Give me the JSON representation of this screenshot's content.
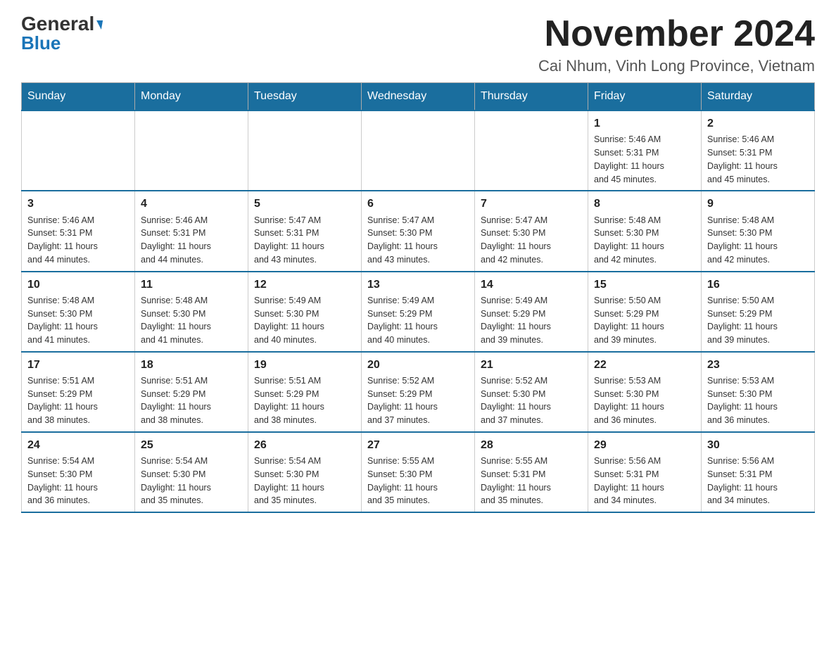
{
  "logo": {
    "general": "General",
    "blue": "Blue"
  },
  "title": "November 2024",
  "subtitle": "Cai Nhum, Vinh Long Province, Vietnam",
  "weekdays": [
    "Sunday",
    "Monday",
    "Tuesday",
    "Wednesday",
    "Thursday",
    "Friday",
    "Saturday"
  ],
  "weeks": [
    [
      {
        "day": "",
        "info": ""
      },
      {
        "day": "",
        "info": ""
      },
      {
        "day": "",
        "info": ""
      },
      {
        "day": "",
        "info": ""
      },
      {
        "day": "",
        "info": ""
      },
      {
        "day": "1",
        "info": "Sunrise: 5:46 AM\nSunset: 5:31 PM\nDaylight: 11 hours\nand 45 minutes."
      },
      {
        "day": "2",
        "info": "Sunrise: 5:46 AM\nSunset: 5:31 PM\nDaylight: 11 hours\nand 45 minutes."
      }
    ],
    [
      {
        "day": "3",
        "info": "Sunrise: 5:46 AM\nSunset: 5:31 PM\nDaylight: 11 hours\nand 44 minutes."
      },
      {
        "day": "4",
        "info": "Sunrise: 5:46 AM\nSunset: 5:31 PM\nDaylight: 11 hours\nand 44 minutes."
      },
      {
        "day": "5",
        "info": "Sunrise: 5:47 AM\nSunset: 5:31 PM\nDaylight: 11 hours\nand 43 minutes."
      },
      {
        "day": "6",
        "info": "Sunrise: 5:47 AM\nSunset: 5:30 PM\nDaylight: 11 hours\nand 43 minutes."
      },
      {
        "day": "7",
        "info": "Sunrise: 5:47 AM\nSunset: 5:30 PM\nDaylight: 11 hours\nand 42 minutes."
      },
      {
        "day": "8",
        "info": "Sunrise: 5:48 AM\nSunset: 5:30 PM\nDaylight: 11 hours\nand 42 minutes."
      },
      {
        "day": "9",
        "info": "Sunrise: 5:48 AM\nSunset: 5:30 PM\nDaylight: 11 hours\nand 42 minutes."
      }
    ],
    [
      {
        "day": "10",
        "info": "Sunrise: 5:48 AM\nSunset: 5:30 PM\nDaylight: 11 hours\nand 41 minutes."
      },
      {
        "day": "11",
        "info": "Sunrise: 5:48 AM\nSunset: 5:30 PM\nDaylight: 11 hours\nand 41 minutes."
      },
      {
        "day": "12",
        "info": "Sunrise: 5:49 AM\nSunset: 5:30 PM\nDaylight: 11 hours\nand 40 minutes."
      },
      {
        "day": "13",
        "info": "Sunrise: 5:49 AM\nSunset: 5:29 PM\nDaylight: 11 hours\nand 40 minutes."
      },
      {
        "day": "14",
        "info": "Sunrise: 5:49 AM\nSunset: 5:29 PM\nDaylight: 11 hours\nand 39 minutes."
      },
      {
        "day": "15",
        "info": "Sunrise: 5:50 AM\nSunset: 5:29 PM\nDaylight: 11 hours\nand 39 minutes."
      },
      {
        "day": "16",
        "info": "Sunrise: 5:50 AM\nSunset: 5:29 PM\nDaylight: 11 hours\nand 39 minutes."
      }
    ],
    [
      {
        "day": "17",
        "info": "Sunrise: 5:51 AM\nSunset: 5:29 PM\nDaylight: 11 hours\nand 38 minutes."
      },
      {
        "day": "18",
        "info": "Sunrise: 5:51 AM\nSunset: 5:29 PM\nDaylight: 11 hours\nand 38 minutes."
      },
      {
        "day": "19",
        "info": "Sunrise: 5:51 AM\nSunset: 5:29 PM\nDaylight: 11 hours\nand 38 minutes."
      },
      {
        "day": "20",
        "info": "Sunrise: 5:52 AM\nSunset: 5:29 PM\nDaylight: 11 hours\nand 37 minutes."
      },
      {
        "day": "21",
        "info": "Sunrise: 5:52 AM\nSunset: 5:30 PM\nDaylight: 11 hours\nand 37 minutes."
      },
      {
        "day": "22",
        "info": "Sunrise: 5:53 AM\nSunset: 5:30 PM\nDaylight: 11 hours\nand 36 minutes."
      },
      {
        "day": "23",
        "info": "Sunrise: 5:53 AM\nSunset: 5:30 PM\nDaylight: 11 hours\nand 36 minutes."
      }
    ],
    [
      {
        "day": "24",
        "info": "Sunrise: 5:54 AM\nSunset: 5:30 PM\nDaylight: 11 hours\nand 36 minutes."
      },
      {
        "day": "25",
        "info": "Sunrise: 5:54 AM\nSunset: 5:30 PM\nDaylight: 11 hours\nand 35 minutes."
      },
      {
        "day": "26",
        "info": "Sunrise: 5:54 AM\nSunset: 5:30 PM\nDaylight: 11 hours\nand 35 minutes."
      },
      {
        "day": "27",
        "info": "Sunrise: 5:55 AM\nSunset: 5:30 PM\nDaylight: 11 hours\nand 35 minutes."
      },
      {
        "day": "28",
        "info": "Sunrise: 5:55 AM\nSunset: 5:31 PM\nDaylight: 11 hours\nand 35 minutes."
      },
      {
        "day": "29",
        "info": "Sunrise: 5:56 AM\nSunset: 5:31 PM\nDaylight: 11 hours\nand 34 minutes."
      },
      {
        "day": "30",
        "info": "Sunrise: 5:56 AM\nSunset: 5:31 PM\nDaylight: 11 hours\nand 34 minutes."
      }
    ]
  ],
  "colors": {
    "header_bg": "#1a6e9e",
    "header_text": "#ffffff"
  }
}
